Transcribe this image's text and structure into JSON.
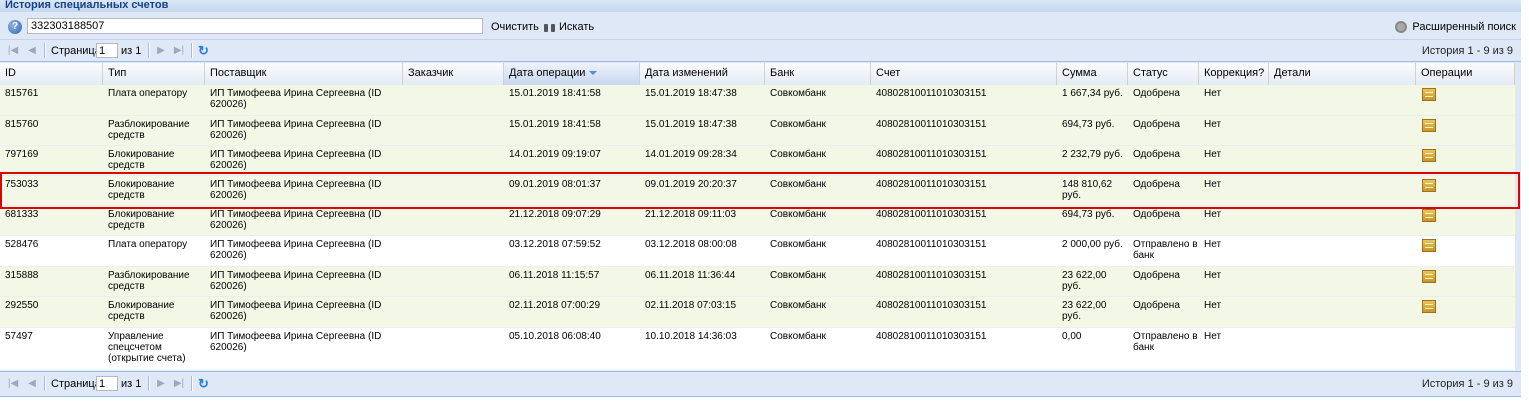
{
  "panel": {
    "title": "История специальных счетов"
  },
  "search": {
    "value": "332303188507",
    "clear_label": "Очистить",
    "search_label": "Искать",
    "advanced_label": "Расширенный поиск"
  },
  "pager": {
    "page_label": "Страница",
    "page_value": "1",
    "of_label": "из 1",
    "info": "История 1 - 9 из 9"
  },
  "columns": {
    "id": "ID",
    "type": "Тип",
    "supplier": "Поставщик",
    "customer": "Заказчик",
    "op_date": "Дата операции",
    "mod_date": "Дата изменений",
    "bank": "Банк",
    "account": "Счет",
    "amount": "Сумма",
    "status": "Статус",
    "correction": "Коррекция?",
    "details": "Детали",
    "operations": "Операции"
  },
  "rows": [
    {
      "id": "815761",
      "type": "Плата оператору",
      "supplier": "ИП Тимофеева Ирина Сергеевна (ID 620026)",
      "op_date": "15.01.2019 18:41:58",
      "mod_date": "15.01.2019 18:47:38",
      "bank": "Совкомбанк",
      "account": "40802810011010303151",
      "amount": "1 667,34 руб.",
      "status": "Одобрена",
      "correction": "Нет"
    },
    {
      "id": "815760",
      "type": "Разблокирование средств",
      "supplier": "ИП Тимофеева Ирина Сергеевна (ID 620026)",
      "op_date": "15.01.2019 18:41:58",
      "mod_date": "15.01.2019 18:47:38",
      "bank": "Совкомбанк",
      "account": "40802810011010303151",
      "amount": "694,73 руб.",
      "status": "Одобрена",
      "correction": "Нет"
    },
    {
      "id": "797169",
      "type": "Блокирование средств",
      "supplier": "ИП Тимофеева Ирина Сергеевна (ID 620026)",
      "op_date": "14.01.2019 09:19:07",
      "mod_date": "14.01.2019 09:28:34",
      "bank": "Совкомбанк",
      "account": "40802810011010303151",
      "amount": "2 232,79 руб.",
      "status": "Одобрена",
      "correction": "Нет"
    },
    {
      "id": "753033",
      "type": "Блокирование средств",
      "supplier": "ИП Тимофеева Ирина Сергеевна (ID 620026)",
      "op_date": "09.01.2019 08:01:37",
      "mod_date": "09.01.2019 20:20:37",
      "bank": "Совкомбанк",
      "account": "40802810011010303151",
      "amount": "148 810,62 руб.",
      "status": "Одобрена",
      "correction": "Нет"
    },
    {
      "id": "681333",
      "type": "Блокирование средств",
      "supplier": "ИП Тимофеева Ирина Сергеевна (ID 620026)",
      "op_date": "21.12.2018 09:07:29",
      "mod_date": "21.12.2018 09:11:03",
      "bank": "Совкомбанк",
      "account": "40802810011010303151",
      "amount": "694,73 руб.",
      "status": "Одобрена",
      "correction": "Нет"
    },
    {
      "id": "528476",
      "type": "Плата оператору",
      "supplier": "ИП Тимофеева Ирина Сергеевна (ID 620026)",
      "op_date": "03.12.2018 07:59:52",
      "mod_date": "03.12.2018 08:00:08",
      "bank": "Совкомбанк",
      "account": "40802810011010303151",
      "amount": "2 000,00 руб.",
      "status": "Отправлено в банк",
      "correction": "Нет"
    },
    {
      "id": "315888",
      "type": "Разблокирование средств",
      "supplier": "ИП Тимофеева Ирина Сергеевна (ID 620026)",
      "op_date": "06.11.2018 11:15:57",
      "mod_date": "06.11.2018 11:36:44",
      "bank": "Совкомбанк",
      "account": "40802810011010303151",
      "amount": "23 622,00 руб.",
      "status": "Одобрена",
      "correction": "Нет"
    },
    {
      "id": "292550",
      "type": "Блокирование средств",
      "supplier": "ИП Тимофеева Ирина Сергеевна (ID 620026)",
      "op_date": "02.11.2018 07:00:29",
      "mod_date": "02.11.2018 07:03:15",
      "bank": "Совкомбанк",
      "account": "40802810011010303151",
      "amount": "23 622,00 руб.",
      "status": "Одобрена",
      "correction": "Нет"
    },
    {
      "id": "57497",
      "type": "Управление спецсчетом (открытие счета)",
      "supplier": "ИП Тимофеева Ирина Сергеевна (ID 620026)",
      "op_date": "05.10.2018 06:08:40",
      "mod_date": "10.10.2018 14:36:03",
      "bank": "Совкомбанк",
      "account": "40802810011010303151",
      "amount": "0,00",
      "status": "Отправлено в банк",
      "correction": "Нет"
    }
  ]
}
